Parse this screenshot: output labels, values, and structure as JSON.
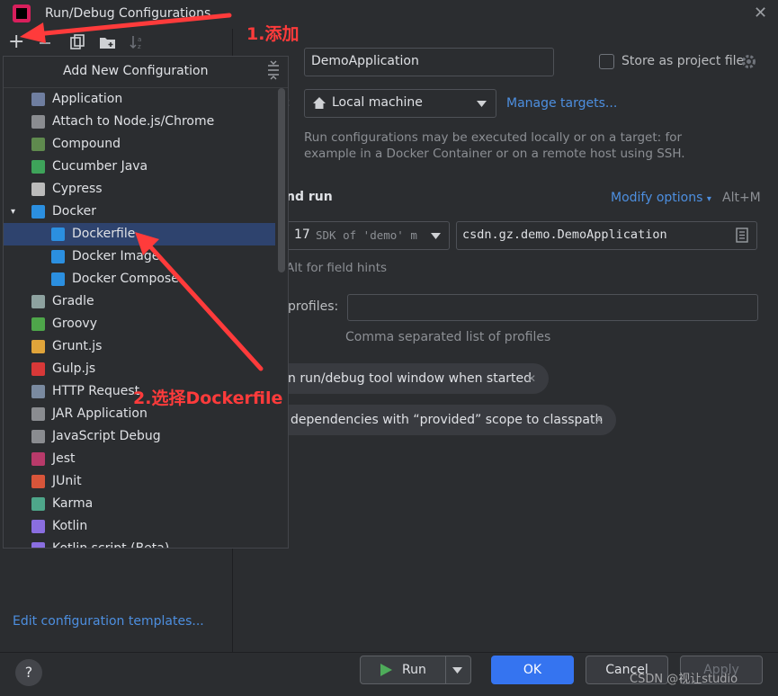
{
  "window": {
    "title": "Run/Debug Configurations",
    "close_glyph": "✕"
  },
  "toolbar": {
    "add_glyph": "+"
  },
  "popup": {
    "title": "Add New Configuration",
    "items": [
      {
        "label": "Application",
        "icon": "application-icon",
        "color": "#6f7ea0"
      },
      {
        "label": "Attach to Node.js/Chrome",
        "icon": "nodejs-icon",
        "color": "#8a8c90"
      },
      {
        "label": "Compound",
        "icon": "compound-icon",
        "color": "#5f8a4e"
      },
      {
        "label": "Cucumber Java",
        "icon": "cucumber-icon",
        "color": "#3ea35a"
      },
      {
        "label": "Cypress",
        "icon": "cypress-icon",
        "color": "#bbbbbb"
      },
      {
        "label": "Docker",
        "icon": "docker-icon",
        "color": "#2b8fe0"
      },
      {
        "label": "Dockerfile",
        "icon": "docker-icon",
        "color": "#2b8fe0"
      },
      {
        "label": "Docker Image",
        "icon": "docker-icon",
        "color": "#2b8fe0"
      },
      {
        "label": "Docker Compose",
        "icon": "docker-icon",
        "color": "#2b8fe0"
      },
      {
        "label": "Gradle",
        "icon": "gradle-icon",
        "color": "#8ea2a0"
      },
      {
        "label": "Groovy",
        "icon": "groovy-icon",
        "color": "#4ea64a"
      },
      {
        "label": "Grunt.js",
        "icon": "grunt-icon",
        "color": "#e0a43a"
      },
      {
        "label": "Gulp.js",
        "icon": "gulp-icon",
        "color": "#d83838"
      },
      {
        "label": "HTTP Request",
        "icon": "api-icon",
        "color": "#7a8aa0"
      },
      {
        "label": "JAR Application",
        "icon": "jar-icon",
        "color": "#8a8c90"
      },
      {
        "label": "JavaScript Debug",
        "icon": "js-debug-icon",
        "color": "#8a8c90"
      },
      {
        "label": "Jest",
        "icon": "jest-icon",
        "color": "#b83a6a"
      },
      {
        "label": "JUnit",
        "icon": "junit-icon",
        "color": "#d8553a"
      },
      {
        "label": "Karma",
        "icon": "karma-icon",
        "color": "#4ea68a"
      },
      {
        "label": "Kotlin",
        "icon": "kotlin-icon",
        "color": "#8a6ee0"
      },
      {
        "label": "Kotlin script (Beta)",
        "icon": "kotlin-icon",
        "color": "#8a6ee0"
      }
    ]
  },
  "left_footer": {
    "templates_link": "Edit configuration templates..."
  },
  "form": {
    "name_value": "DemoApplication",
    "store_label": "Store as project file",
    "target_partial_label": ":",
    "target_value": "Local machine",
    "manage_targets": "Manage targets...",
    "info_line1": "Run configurations may be executed locally or on a target: for",
    "info_line2": "example in a Docker Container or on a remote host using SSH.",
    "section_title": "nd run",
    "modify_options": "Modify options",
    "modify_shortcut": "Alt+M",
    "sdk_value": "17",
    "sdk_hint": "SDK of 'demo' m",
    "main_class": "csdn.gz.demo.DemoApplication",
    "hint_text": "Alt for field hints",
    "profiles_label": "profiles:",
    "profiles_hint": "Comma separated list of profiles",
    "pill1": "n run/debug tool window when started",
    "pill2": "dependencies with “provided” scope to classpath"
  },
  "footer": {
    "help": "?",
    "run": "Run",
    "ok": "OK",
    "cancel": "Cancel",
    "apply": "Apply",
    "watermark": "CSDN @视让studio"
  },
  "annotations": {
    "step1": "1.添加",
    "step2": "2.选择Dockerfile",
    "color": "#ff3b3b"
  }
}
